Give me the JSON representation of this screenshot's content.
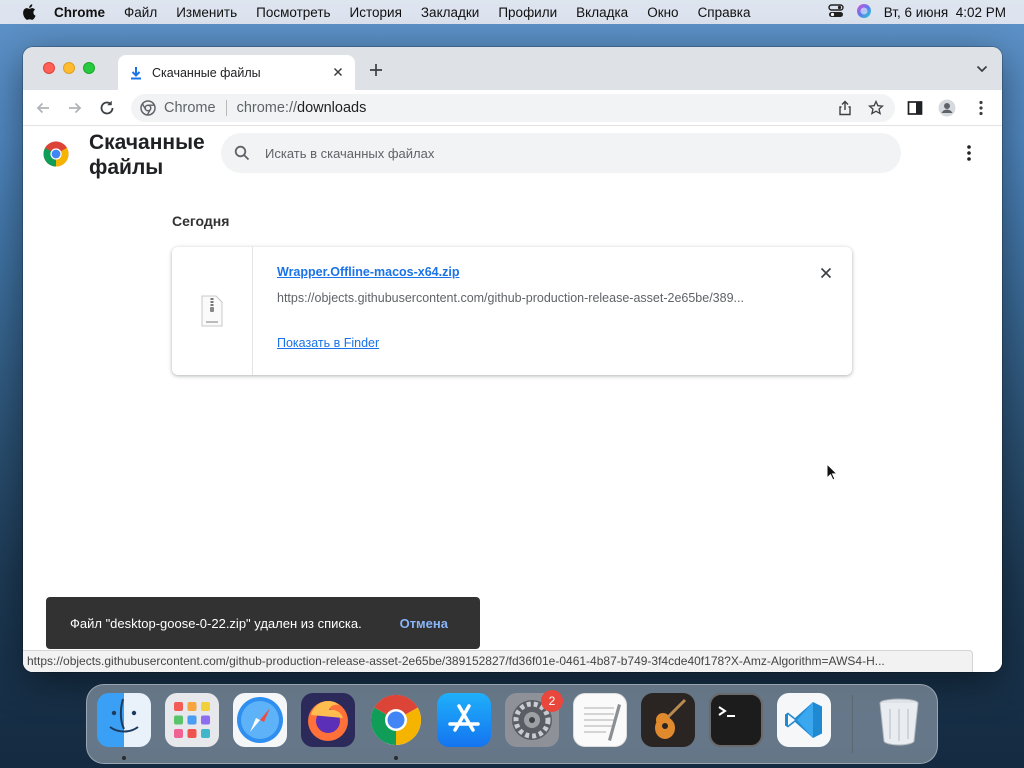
{
  "menubar": {
    "app_name": "Chrome",
    "items": [
      "Файл",
      "Изменить",
      "Посмотреть",
      "История",
      "Закладки",
      "Профили",
      "Вкладка",
      "Окно",
      "Справка"
    ],
    "datetime": "Вт, 6 июня  4:02 PM"
  },
  "tab": {
    "title": "Скачанные файлы"
  },
  "toolbar": {
    "site_label": "Chrome",
    "url_scheme": "chrome://",
    "url_host": "downloads"
  },
  "page": {
    "title": "Скачанные файлы",
    "search_placeholder": "Искать в скачанных файлах",
    "date_header": "Сегодня"
  },
  "download": {
    "filename": "Wrapper.Offline-macos-x64.zip",
    "url": "https://objects.githubusercontent.com/github-production-release-asset-2e65be/389...",
    "action_label": "Показать в Finder"
  },
  "toast": {
    "message": "Файл \"desktop-goose-0-22.zip\" удален из списка.",
    "undo_label": "Отмена"
  },
  "statusbar": {
    "text": "https://objects.githubusercontent.com/github-production-release-asset-2e65be/389152827/fd36f01e-0461-4b87-b749-3f4cde40f178?X-Amz-Algorithm=AWS4-H..."
  },
  "dock": {
    "apps": [
      "Finder",
      "Launchpad",
      "Safari",
      "Firefox",
      "Chrome",
      "App Store",
      "System Preferences",
      "TextEdit",
      "GarageBand",
      "Terminal",
      "Visual Studio Code",
      "Trash"
    ],
    "settings_badge": "2"
  },
  "colors": {
    "accent": "#1a73e8",
    "toast_bg": "#323232",
    "toast_action": "#8ab4f8"
  }
}
